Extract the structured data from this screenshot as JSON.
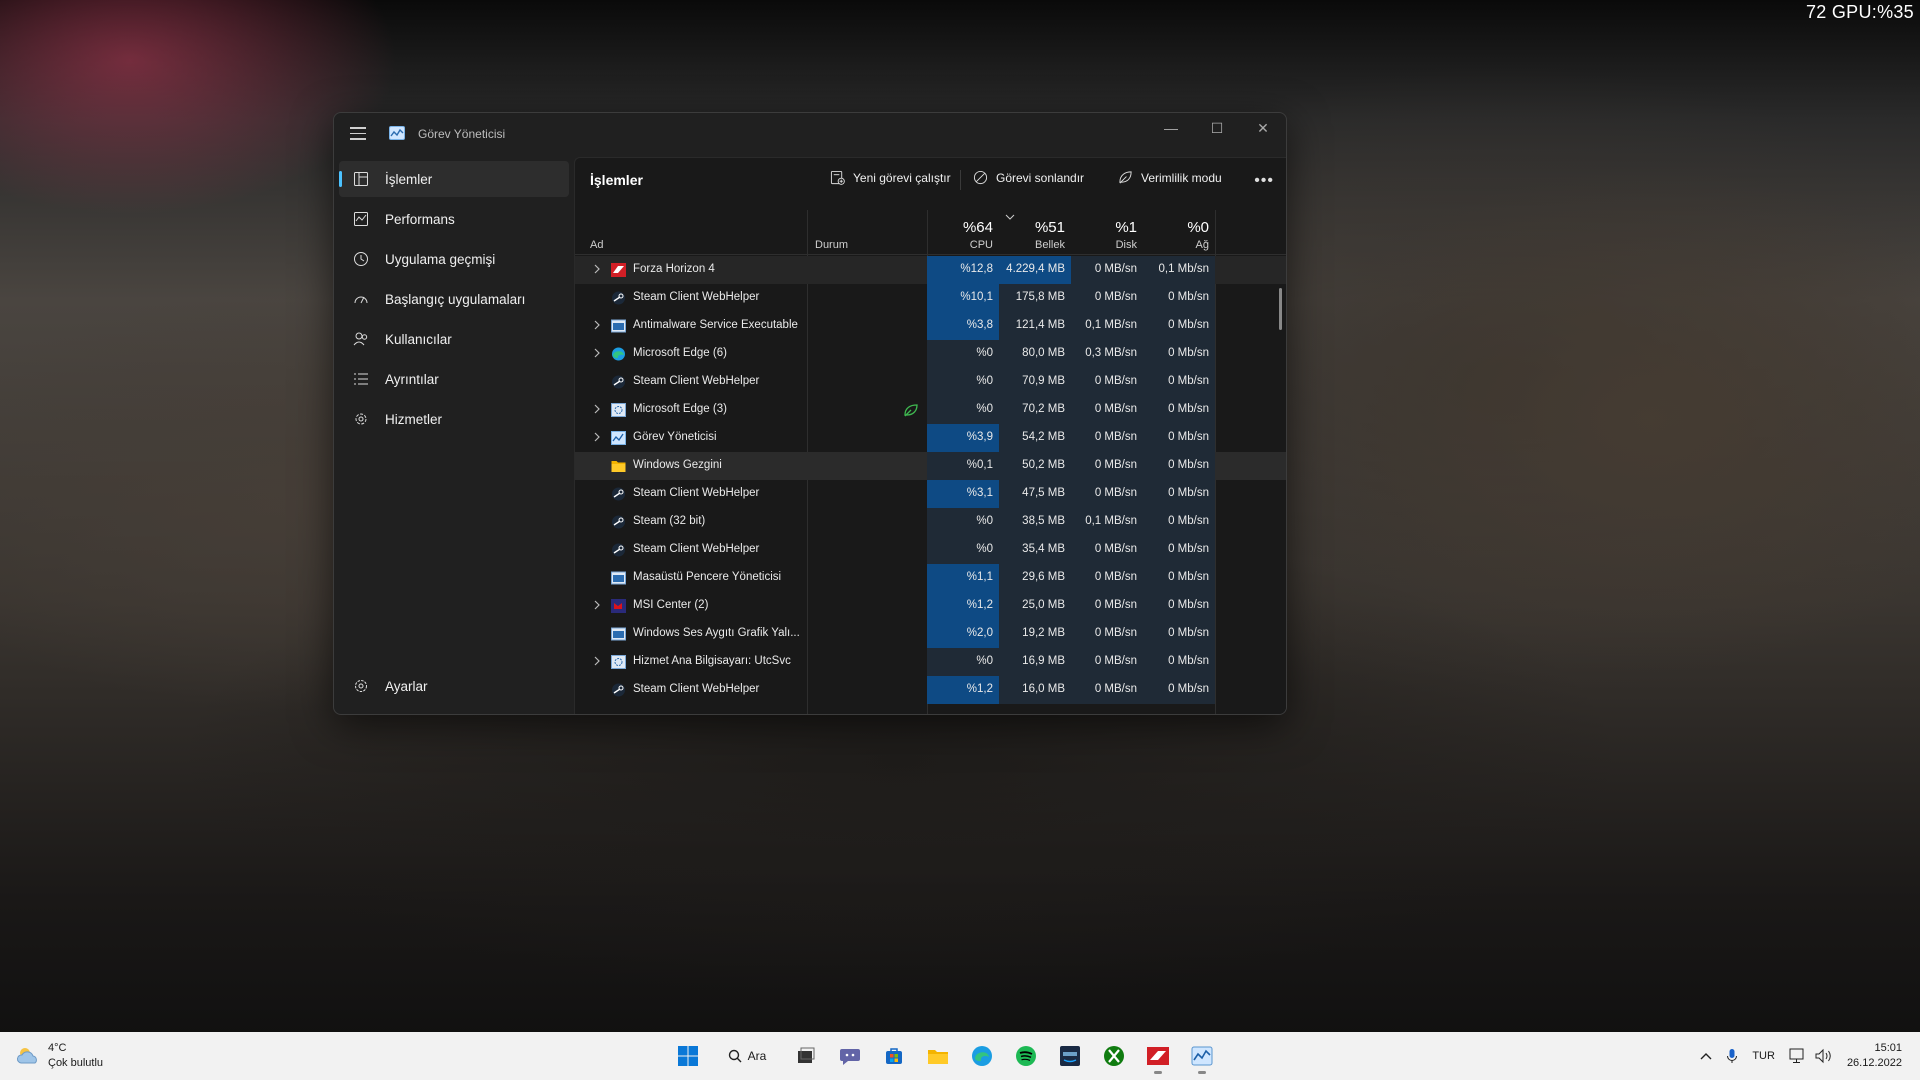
{
  "overlay": {
    "text": "72 GPU:%35"
  },
  "window": {
    "title": "Görev Yöneticisi",
    "controls": {
      "minimize": "—",
      "maximize": "☐",
      "close": "✕"
    }
  },
  "sidebar": {
    "items": [
      {
        "label": "İşlemler",
        "icon": "processes-icon"
      },
      {
        "label": "Performans",
        "icon": "performance-icon"
      },
      {
        "label": "Uygulama geçmişi",
        "icon": "history-icon"
      },
      {
        "label": "Başlangıç uygulamaları",
        "icon": "startup-icon"
      },
      {
        "label": "Kullanıcılar",
        "icon": "users-icon"
      },
      {
        "label": "Ayrıntılar",
        "icon": "details-icon"
      },
      {
        "label": "Hizmetler",
        "icon": "services-icon"
      }
    ],
    "settings": "Ayarlar"
  },
  "toolbar": {
    "title": "İşlemler",
    "run_task": "Yeni görevi çalıştır",
    "end_task": "Görevi sonlandır",
    "efficiency": "Verimlilik modu",
    "more": "•••"
  },
  "columns": {
    "name": "Ad",
    "status": "Durum",
    "cpu": {
      "pct": "%64",
      "label": "CPU"
    },
    "memory": {
      "pct": "%51",
      "label": "Bellek"
    },
    "disk": {
      "pct": "%1",
      "label": "Disk"
    },
    "network": {
      "pct": "%0",
      "label": "Ağ"
    }
  },
  "rows": [
    {
      "name": "Forza Horizon 4",
      "expand": true,
      "icon": "forza",
      "cpu": "%12,8",
      "mem": "4.229,4 MB",
      "disk": "0 MB/sn",
      "net": "0,1 Mb/sn",
      "hl": true
    },
    {
      "name": "Steam Client WebHelper",
      "expand": false,
      "icon": "steam",
      "cpu": "%10,1",
      "mem": "175,8 MB",
      "disk": "0 MB/sn",
      "net": "0 Mb/sn"
    },
    {
      "name": "Antimalware Service Executable",
      "expand": true,
      "icon": "sys",
      "cpu": "%3,8",
      "mem": "121,4 MB",
      "disk": "0,1 MB/sn",
      "net": "0 Mb/sn"
    },
    {
      "name": "Microsoft Edge (6)",
      "expand": true,
      "icon": "edge",
      "cpu": "%0",
      "mem": "80,0 MB",
      "disk": "0,3 MB/sn",
      "net": "0 Mb/sn"
    },
    {
      "name": "Steam Client WebHelper",
      "expand": false,
      "icon": "steam",
      "cpu": "%0",
      "mem": "70,9 MB",
      "disk": "0 MB/sn",
      "net": "0 Mb/sn"
    },
    {
      "name": "Microsoft Edge (3)",
      "expand": true,
      "icon": "gear",
      "cpu": "%0",
      "mem": "70,2 MB",
      "disk": "0 MB/sn",
      "net": "0 Mb/sn",
      "eco": true
    },
    {
      "name": "Görev Yöneticisi",
      "expand": true,
      "icon": "taskmgr",
      "cpu": "%3,9",
      "mem": "54,2 MB",
      "disk": "0 MB/sn",
      "net": "0 Mb/sn"
    },
    {
      "name": "Windows Gezgini",
      "expand": false,
      "icon": "folder",
      "cpu": "%0,1",
      "mem": "50,2 MB",
      "disk": "0 MB/sn",
      "net": "0 Mb/sn",
      "hover": true
    },
    {
      "name": "Steam Client WebHelper",
      "expand": false,
      "icon": "steam",
      "cpu": "%3,1",
      "mem": "47,5 MB",
      "disk": "0 MB/sn",
      "net": "0 Mb/sn"
    },
    {
      "name": "Steam (32 bit)",
      "expand": false,
      "icon": "steam",
      "cpu": "%0",
      "mem": "38,5 MB",
      "disk": "0,1 MB/sn",
      "net": "0 Mb/sn"
    },
    {
      "name": "Steam Client WebHelper",
      "expand": false,
      "icon": "steam",
      "cpu": "%0",
      "mem": "35,4 MB",
      "disk": "0 MB/sn",
      "net": "0 Mb/sn"
    },
    {
      "name": "Masaüstü Pencere Yöneticisi",
      "expand": false,
      "icon": "sys",
      "cpu": "%1,1",
      "mem": "29,6 MB",
      "disk": "0 MB/sn",
      "net": "0 Mb/sn"
    },
    {
      "name": "MSI Center (2)",
      "expand": true,
      "icon": "msi",
      "cpu": "%1,2",
      "mem": "25,0 MB",
      "disk": "0 MB/sn",
      "net": "0 Mb/sn"
    },
    {
      "name": "Windows Ses Aygıtı Grafik Yalı...",
      "expand": false,
      "icon": "sys",
      "cpu": "%2,0",
      "mem": "19,2 MB",
      "disk": "0 MB/sn",
      "net": "0 Mb/sn"
    },
    {
      "name": "Hizmet Ana Bilgisayarı: UtcSvc",
      "expand": true,
      "icon": "gear",
      "cpu": "%0",
      "mem": "16,9 MB",
      "disk": "0 MB/sn",
      "net": "0 Mb/sn"
    },
    {
      "name": "Steam Client WebHelper",
      "expand": false,
      "icon": "steam",
      "cpu": "%1,2",
      "mem": "16,0 MB",
      "disk": "0 MB/sn",
      "net": "0 Mb/sn"
    }
  ],
  "taskbar": {
    "temp": "4°C",
    "weather": "Çok bulutlu",
    "search": "Ara",
    "lang": "TUR",
    "time": "15:01",
    "date": "26.12.2022"
  },
  "colors": {
    "accent": "#4cc2ff",
    "cpu_heat_strong": "#0e4a84",
    "cpu_heat_mid": "#14406e",
    "cell_default": "#1f2a36",
    "eco_green": "#3fb950"
  }
}
